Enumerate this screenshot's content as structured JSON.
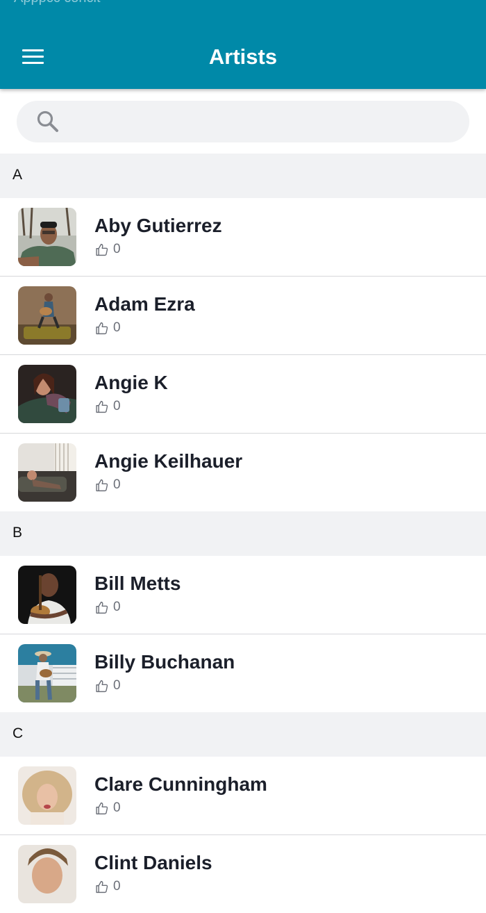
{
  "status_bar": {
    "text": "Apppcc concit"
  },
  "header": {
    "title": "Artists",
    "menu_icon": "hamburger-menu-icon"
  },
  "search": {
    "value": "",
    "placeholder": "",
    "icon": "search-icon"
  },
  "colors": {
    "header_bg": "#0089a8",
    "section_bg": "#f1f2f4",
    "name_text": "#1b1f2a",
    "divider": "#d6d7da"
  },
  "sections": [
    {
      "letter": "A",
      "artists": [
        {
          "name": "Aby Gutierrez",
          "likes": "0"
        },
        {
          "name": "Adam Ezra",
          "likes": "0"
        },
        {
          "name": "Angie K",
          "likes": "0"
        },
        {
          "name": "Angie Keilhauer",
          "likes": "0"
        }
      ]
    },
    {
      "letter": "B",
      "artists": [
        {
          "name": "Bill Metts",
          "likes": "0"
        },
        {
          "name": "Billy Buchanan",
          "likes": "0"
        }
      ]
    },
    {
      "letter": "C",
      "artists": [
        {
          "name": "Clare Cunningham",
          "likes": "0"
        },
        {
          "name": "Clint Daniels",
          "likes": "0"
        }
      ]
    }
  ]
}
